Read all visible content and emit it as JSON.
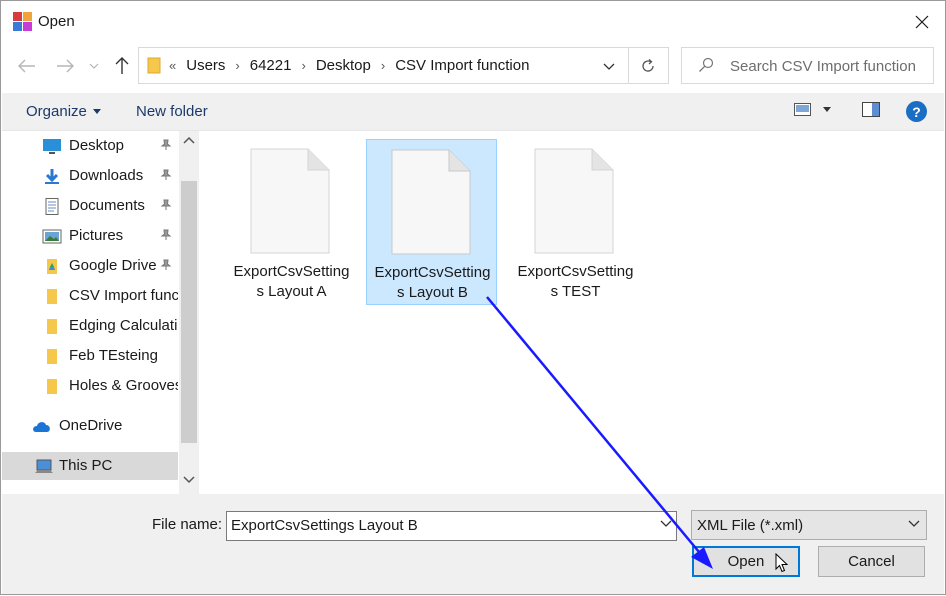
{
  "window": {
    "title": "Open"
  },
  "address": {
    "overflow": "«",
    "crumbs": [
      "Users",
      "64221",
      "Desktop",
      "CSV Import function"
    ]
  },
  "search": {
    "placeholder": "Search CSV Import function"
  },
  "toolbar": {
    "organize": "Organize",
    "new_folder": "New folder",
    "help": "?"
  },
  "sidebar": {
    "items": [
      {
        "label": "Desktop",
        "icon": "desktop-icon",
        "pinned": true
      },
      {
        "label": "Downloads",
        "icon": "download-icon",
        "pinned": true
      },
      {
        "label": "Documents",
        "icon": "documents-icon",
        "pinned": true
      },
      {
        "label": "Pictures",
        "icon": "pictures-icon",
        "pinned": true
      },
      {
        "label": "Google Drive",
        "icon": "google-drive-folder-icon",
        "pinned": true
      },
      {
        "label": "CSV Import function",
        "icon": "folder-icon",
        "pinned": false
      },
      {
        "label": "Edging Calculation",
        "icon": "folder-icon",
        "pinned": false
      },
      {
        "label": "Feb TEsteing",
        "icon": "folder-icon",
        "pinned": false
      },
      {
        "label": "Holes & Grooves",
        "icon": "folder-icon",
        "pinned": false
      },
      {
        "label": "OneDrive",
        "icon": "onedrive-icon",
        "pinned": false
      },
      {
        "label": "This PC",
        "icon": "this-pc-icon",
        "pinned": false,
        "selected": true
      }
    ]
  },
  "files": [
    {
      "line1": "ExportCsvSetting",
      "line2": "s Layout A",
      "selected": false
    },
    {
      "line1": "ExportCsvSetting",
      "line2": "s Layout B",
      "selected": true
    },
    {
      "line1": "ExportCsvSetting",
      "line2": "s TEST",
      "selected": false
    }
  ],
  "bottom": {
    "file_name_label": "File name:",
    "file_name_value": "ExportCsvSettings Layout B",
    "file_type_value": "XML File (*.xml)",
    "open_label": "Open",
    "cancel_label": "Cancel"
  },
  "colors": {
    "accent": "#0078d7",
    "selection": "#cce8ff",
    "annotation_arrow": "#1a1aff"
  }
}
